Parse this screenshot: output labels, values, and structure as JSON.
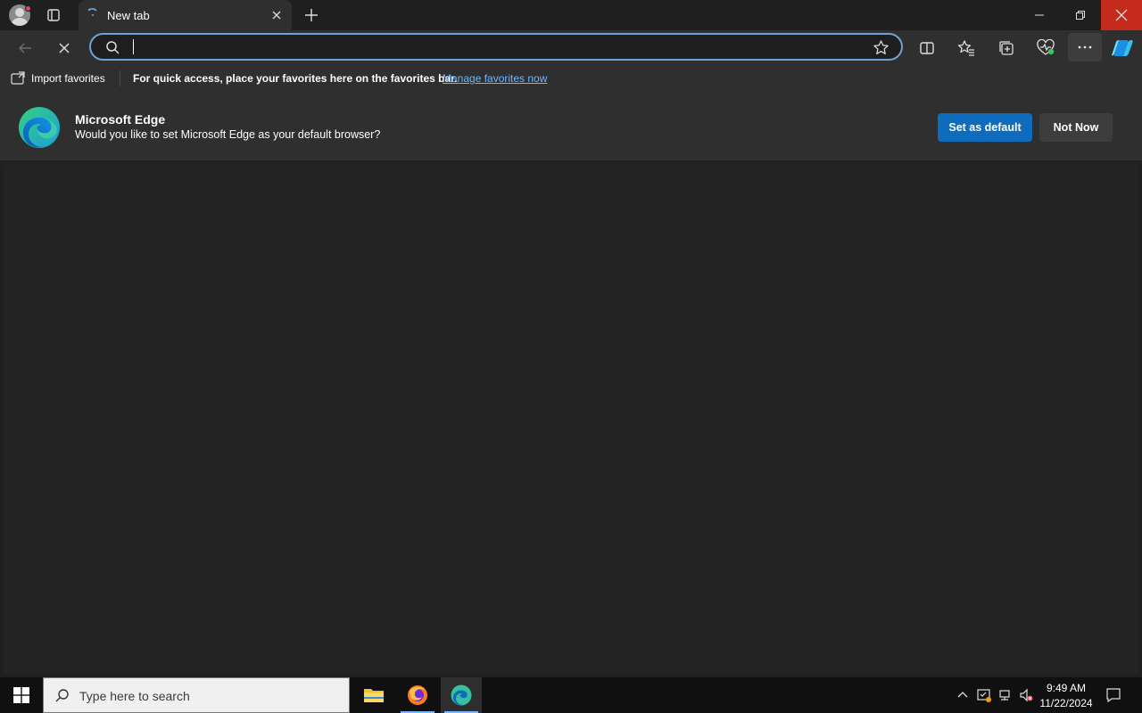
{
  "browser": {
    "tab_title": "New tab",
    "address_value": "",
    "address_placeholder": ""
  },
  "favorites_bar": {
    "import_label": "Import favorites",
    "message": "For quick access, place your favorites here on the favorites bar.",
    "link_label": "Manage favorites now"
  },
  "infobar": {
    "title": "Microsoft Edge",
    "subtitle": "Would you like to set Microsoft Edge as your default browser?",
    "primary_button": "Set as default",
    "secondary_button": "Not Now"
  },
  "taskbar": {
    "search_placeholder": "Type here to search",
    "time": "9:49 AM",
    "date": "11/22/2024",
    "apps": [
      "file-explorer",
      "firefox",
      "microsoft-edge"
    ]
  },
  "icons": {
    "titlebar": [
      "profile-avatar",
      "tab-actions-icon",
      "tab-loading-icon",
      "tab-close-icon",
      "new-tab-icon",
      "minimize-icon",
      "restore-icon",
      "close-icon"
    ],
    "toolbar": [
      "back-icon",
      "stop-icon",
      "search-icon",
      "favorite-star-icon",
      "split-screen-icon",
      "favorites-icon",
      "collections-icon",
      "browser-essentials-icon",
      "more-icon",
      "copilot-icon"
    ]
  },
  "colors": {
    "accent": "#0f6cbd",
    "link": "#6fb7ff",
    "close_hover": "#c42b1c"
  }
}
